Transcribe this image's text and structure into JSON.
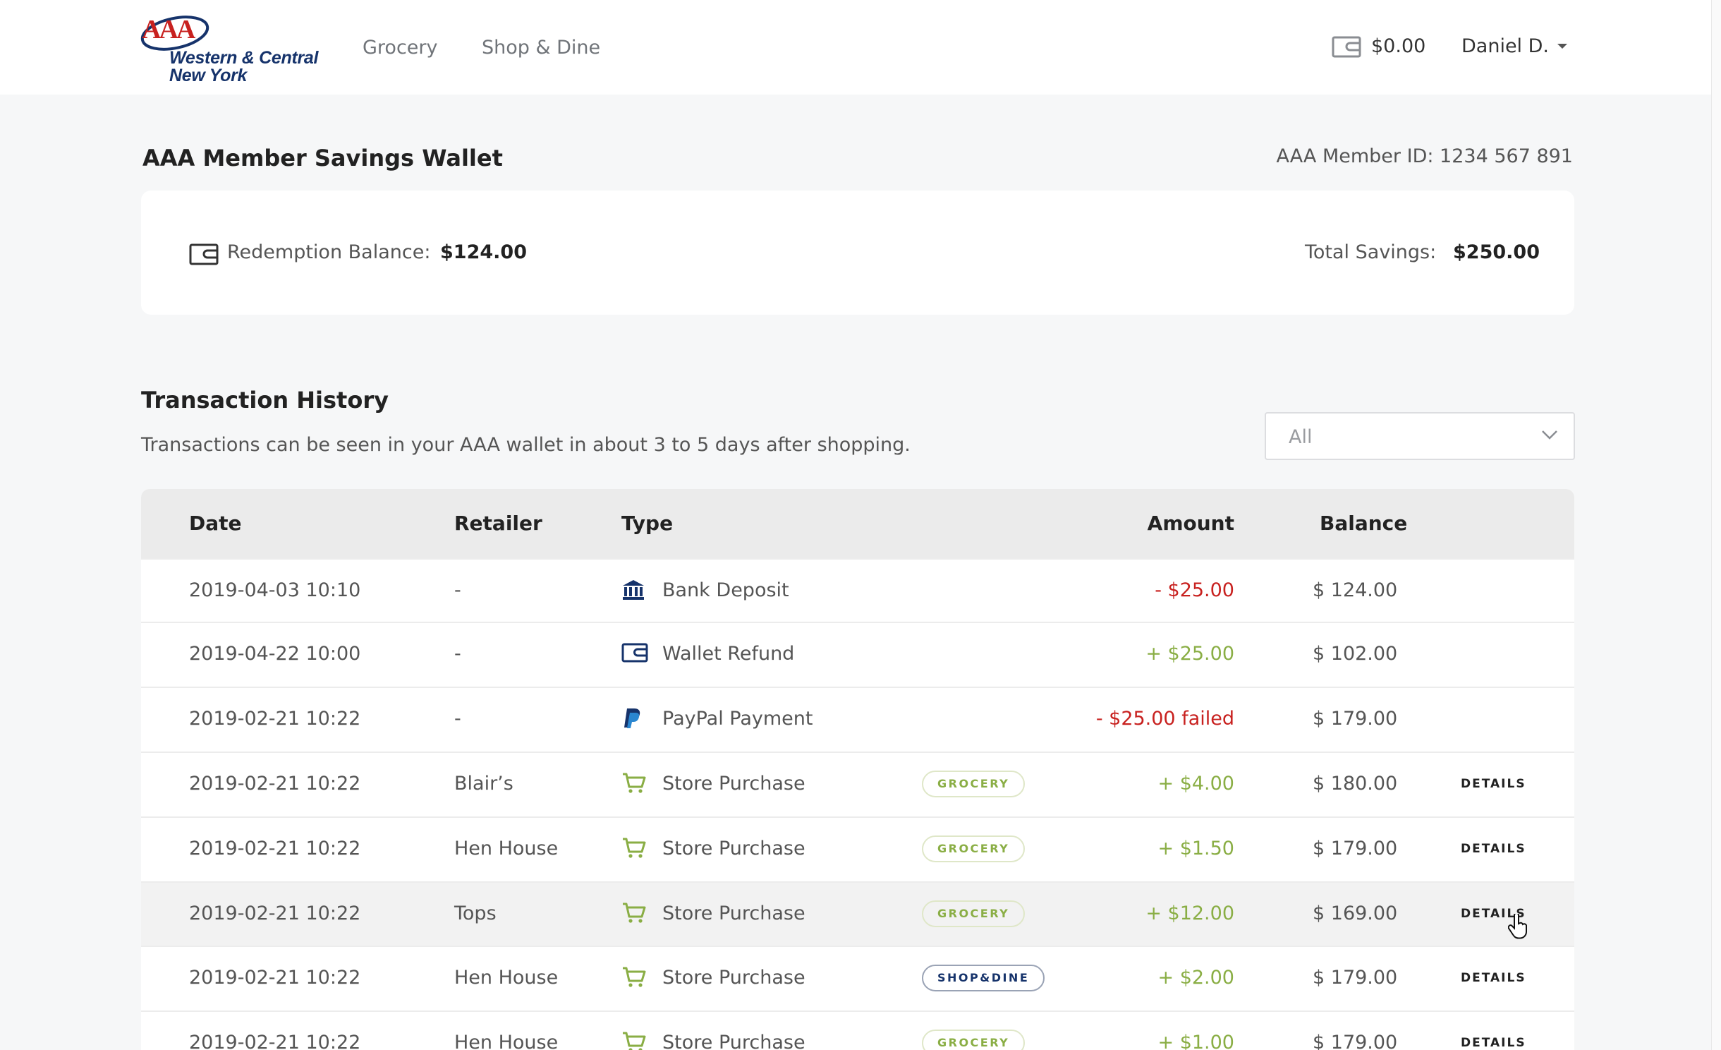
{
  "header": {
    "logo_line1": "Western & Central",
    "logo_line2": "New York",
    "nav": [
      "Grocery",
      "Shop & Dine"
    ],
    "wallet_balance": "$0.00",
    "user_name": "Daniel D."
  },
  "wallet": {
    "title": "AAA Member Savings Wallet",
    "member_id": "AAA Member ID: 1234 567 891",
    "redemption_label": "Redemption Balance:",
    "redemption_value": "$124.00",
    "total_label": "Total Savings:",
    "total_value": "$250.00"
  },
  "history": {
    "title": "Transaction History",
    "subtitle": "Transactions can be seen in your AAA wallet in about 3 to 5 days after shopping.",
    "filter_value": "All",
    "columns": [
      "Date",
      "Retailer",
      "Type",
      "Amount",
      "Balance"
    ],
    "rows": [
      {
        "date": "2019-04-03  10:10",
        "retailer": "-",
        "type": "Bank Deposit",
        "icon": "bank-icon",
        "badge": "",
        "amount": "- $25.00",
        "sign": "neg",
        "balance": "$ 124.00",
        "details": ""
      },
      {
        "date": "2019-04-22  10:00",
        "retailer": "-",
        "type": "Wallet Refund",
        "icon": "wallet-icon",
        "badge": "",
        "amount": "+ $25.00",
        "sign": "pos",
        "balance": "$ 102.00",
        "details": ""
      },
      {
        "date": "2019-02-21 10:22",
        "retailer": "-",
        "type": "PayPal Payment",
        "icon": "paypal-icon",
        "badge": "",
        "amount": "- $25.00 failed",
        "sign": "neg",
        "balance": "$ 179.00",
        "details": ""
      },
      {
        "date": "2019-02-21 10:22",
        "retailer": "Blair’s",
        "type": "Store Purchase",
        "icon": "cart-icon",
        "badge": "GROCERY",
        "amount": "+ $4.00",
        "sign": "pos",
        "balance": "$ 180.00",
        "details": "DETAILS"
      },
      {
        "date": "2019-02-21 10:22",
        "retailer": "Hen House",
        "type": "Store Purchase",
        "icon": "cart-icon",
        "badge": "GROCERY",
        "amount": "+ $1.50",
        "sign": "pos",
        "balance": "$ 179.00",
        "details": "DETAILS"
      },
      {
        "date": "2019-02-21 10:22",
        "retailer": "Tops",
        "type": "Store Purchase",
        "icon": "cart-icon",
        "badge": "GROCERY",
        "amount": "+ $12.00",
        "sign": "pos",
        "balance": "$ 169.00",
        "details": "DETAILS"
      },
      {
        "date": "2019-02-21 10:22",
        "retailer": "Hen House",
        "type": "Store Purchase",
        "icon": "cart-icon",
        "badge": "SHOP&DINE",
        "amount": "+ $2.00",
        "sign": "pos",
        "balance": "$ 179.00",
        "details": "DETAILS"
      },
      {
        "date": "2019-02-21 10:22",
        "retailer": "Hen House",
        "type": "Store Purchase",
        "icon": "cart-icon",
        "badge": "GROCERY",
        "amount": "+ $1.00",
        "sign": "pos",
        "balance": "$ 179.00",
        "details": "DETAILS"
      }
    ]
  },
  "colors": {
    "brand_navy": "#16336b",
    "brand_red": "#c8211f",
    "positive": "#8aae45",
    "negative": "#c8211f"
  }
}
